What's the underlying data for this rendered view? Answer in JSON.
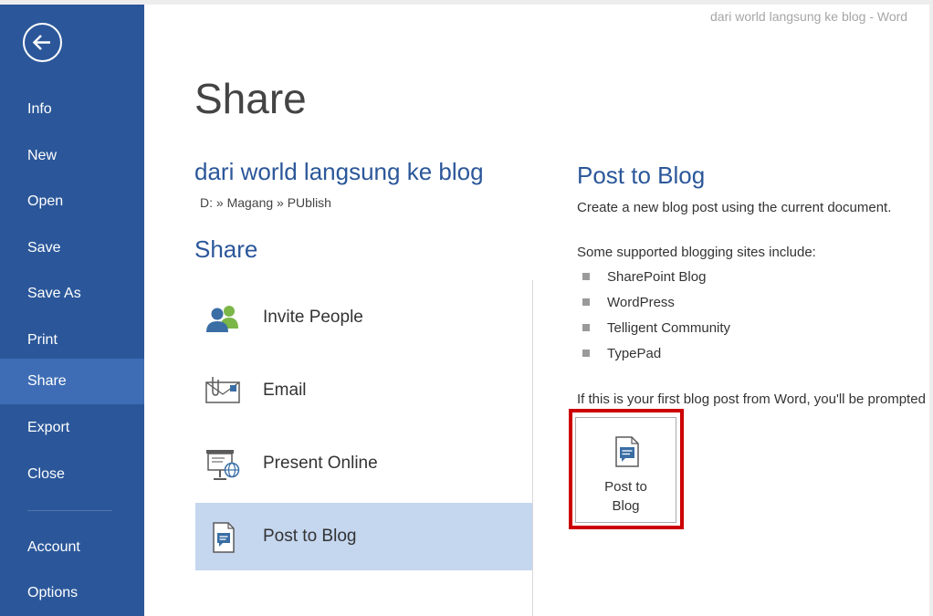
{
  "window": {
    "title": "dari world langsung ke blog - Word"
  },
  "nav": {
    "back_icon": "back-arrow-icon",
    "items": [
      {
        "label": "Info"
      },
      {
        "label": "New"
      },
      {
        "label": "Open"
      },
      {
        "label": "Save"
      },
      {
        "label": "Save As"
      },
      {
        "label": "Print"
      },
      {
        "label": "Share",
        "active": true
      },
      {
        "label": "Export"
      },
      {
        "label": "Close"
      },
      {
        "label": "Account"
      },
      {
        "label": "Options"
      }
    ]
  },
  "page": {
    "title": "Share",
    "document_name": "dari world langsung ke blog",
    "document_path": "D: » Magang » PUblish",
    "section_title": "Share"
  },
  "share_options": [
    {
      "label": "Invite People",
      "icon": "invite-people-icon"
    },
    {
      "label": "Email",
      "icon": "email-icon"
    },
    {
      "label": "Present Online",
      "icon": "present-online-icon"
    },
    {
      "label": "Post to Blog",
      "icon": "post-to-blog-icon",
      "selected": true
    }
  ],
  "panel": {
    "title": "Post to Blog",
    "description": "Create a new blog post using the current document.",
    "sites_intro": "Some supported blogging sites include:",
    "sites": [
      "SharePoint Blog",
      "WordPress",
      "Telligent Community",
      "TypePad"
    ],
    "first_post_note": "If this is your first blog post from Word, you'll be prompted to register your blog account.",
    "button_label_line1": "Post to",
    "button_label_line2": "Blog"
  },
  "colors": {
    "nav_bg": "#2b579a",
    "nav_active": "#3e6db5",
    "accent": "#2b579a",
    "selected_bg": "#c5d6ef",
    "highlight": "#cc0000"
  }
}
